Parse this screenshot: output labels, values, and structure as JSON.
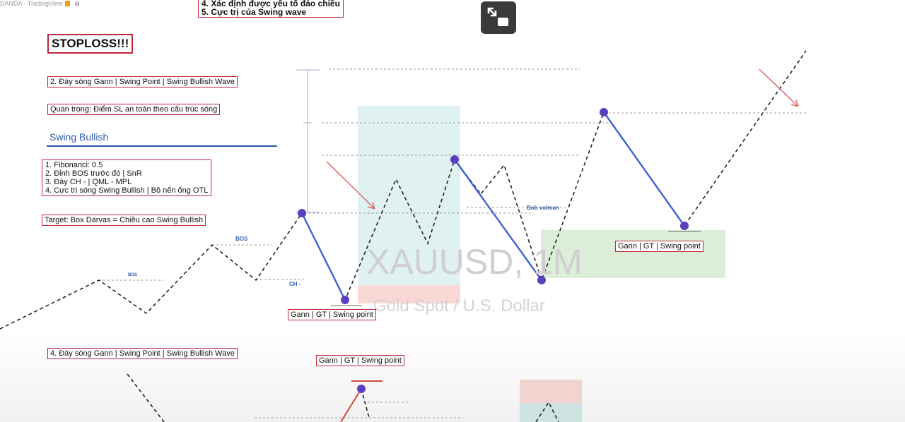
{
  "tradingview": {
    "brand": "DANDA - TradingView"
  },
  "top_note": {
    "line4": "4. Xác định được yếu tố đảo chiều",
    "line5": "5. Cực trị của Swing wave"
  },
  "annotations": {
    "stoploss": "STOPLOSS!!!",
    "gann_swing_2": "2. Đáy sóng Gann | Swing Point | Swing Bullish Wave",
    "quan_trong": "Quan trọng: Điểm SL an toàn theo cấu trúc sóng",
    "swing_bullish": "Swing Bullish",
    "list": [
      "1. Fibonanci: 0.5",
      "2. Đỉnh BOS trước đó | SnR",
      "3. Đáy CH - | QML - MPL",
      "4. Cực trị sóng Swing Bullish | Bộ nến ống OTL"
    ],
    "target": "Target: Box Darvas = Chiều cao Swing Bullish",
    "gann_gt_sp_1": "Gann | GT | Swing point",
    "gann_gt_sp_2": "Gann | GT | Swing point",
    "gann_swing_4": "4. Đáy sóng Gann | Swing Point | Swing Bullish Wave",
    "gann_gt_sp_3": "Gann | GT | Swing point"
  },
  "chart_labels": {
    "bos_small": "BOS",
    "bos": "BOS",
    "ch": "CH -",
    "bob_volman": "Bob volman"
  },
  "watermark": {
    "symbol": "XAUUSD, 1M",
    "description": "Gold Spot / U.S. Dollar"
  },
  "controls": {
    "zoom_icon": "exit-fullscreen-icon"
  },
  "colors": {
    "annotation_border": "#c0263c",
    "wave_blue": "#3b63d6",
    "point_purple": "#5b3fbf",
    "label_blue": "#2e5aa8",
    "arrow_red": "#e06060"
  }
}
